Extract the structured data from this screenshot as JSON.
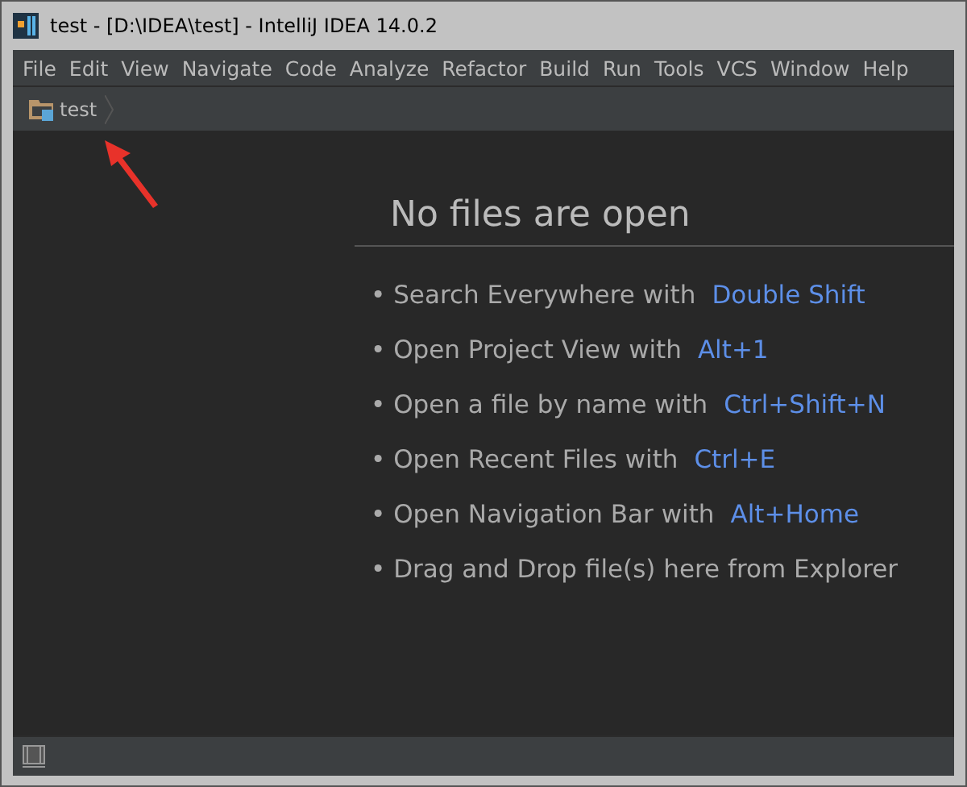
{
  "window": {
    "title": "test - [D:\\IDEA\\test] - IntelliJ IDEA 14.0.2"
  },
  "menu": [
    "File",
    "Edit",
    "View",
    "Navigate",
    "Code",
    "Analyze",
    "Refactor",
    "Build",
    "Run",
    "Tools",
    "VCS",
    "Window",
    "Help"
  ],
  "breadcrumb": {
    "label": "test"
  },
  "editor": {
    "heading": "No files are open",
    "hints": [
      {
        "text": "• Search Everywhere with",
        "shortcut": "Double Shift"
      },
      {
        "text": "• Open Project View with",
        "shortcut": "Alt+1"
      },
      {
        "text": "• Open a file by name with",
        "shortcut": "Ctrl+Shift+N"
      },
      {
        "text": "• Open Recent Files with",
        "shortcut": "Ctrl+E"
      },
      {
        "text": "• Open Navigation Bar with",
        "shortcut": "Alt+Home"
      },
      {
        "text": "• Drag and Drop file(s) here from Explorer"
      }
    ]
  }
}
